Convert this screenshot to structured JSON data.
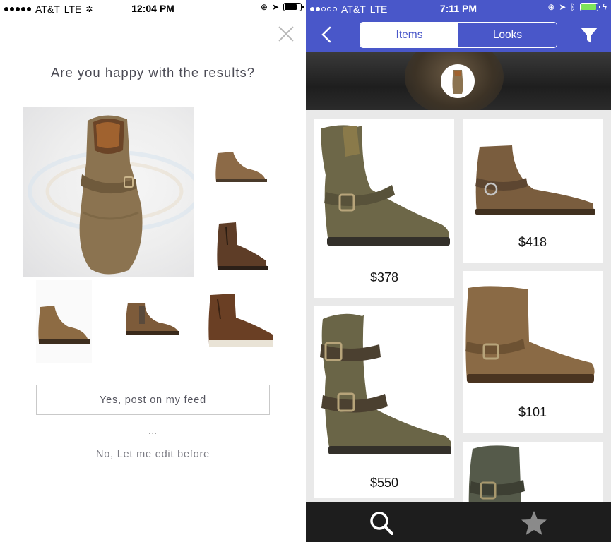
{
  "left_screen": {
    "status_bar": {
      "carrier": "AT&T",
      "network": "LTE",
      "time": "12:04 PM"
    },
    "question": "Are you happy with the results?",
    "yes_button_label": "Yes, post on my feed",
    "ellipsis": "...",
    "no_link_label": "No, Let me edit before"
  },
  "right_screen": {
    "status_bar": {
      "carrier": "AT&T",
      "network": "LTE",
      "time": "7:11 PM"
    },
    "tabs": [
      {
        "label": "Items",
        "active": true
      },
      {
        "label": "Looks",
        "active": false
      }
    ],
    "products": [
      {
        "price": "$378"
      },
      {
        "price": "$418"
      },
      {
        "price": "$550"
      },
      {
        "price": "$101"
      },
      {
        "price": ""
      }
    ],
    "bottom_tabs": [
      {
        "icon": "search-icon"
      },
      {
        "icon": "star-icon"
      }
    ]
  },
  "colors": {
    "accent": "#4957c9",
    "battery_green": "#7ee35a",
    "tabbar": "#1d1d1d",
    "boot_brown": "#8a6a45",
    "boot_olive": "#6b6545"
  }
}
